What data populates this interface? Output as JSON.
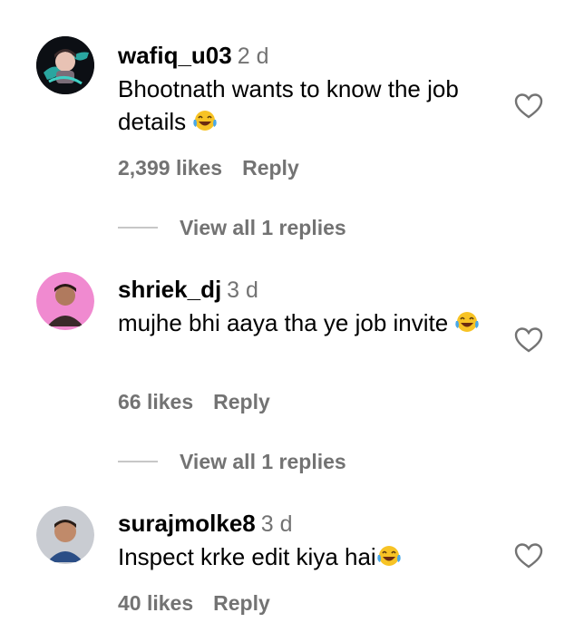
{
  "comments": [
    {
      "username": "wafiq_u03",
      "time": "2 d",
      "text": "Bhootnath wants to know the job details",
      "emoji": "😂",
      "likes": "2,399 likes",
      "reply_label": "Reply",
      "view_replies": "View all 1 replies",
      "avatar_icon": "anime-character-avatar"
    },
    {
      "username": "shriek_dj",
      "time": "3 d",
      "text": "mujhe bhi aaya tha ye job invite",
      "emoji": "😂",
      "likes": "66 likes",
      "reply_label": "Reply",
      "view_replies": "View all 1 replies",
      "avatar_icon": "person-photo-avatar"
    },
    {
      "username": "surajmolke8",
      "time": "3 d",
      "text": "Inspect krke edit kiya hai",
      "emoji": "😂",
      "likes": "40 likes",
      "reply_label": "Reply",
      "avatar_icon": "person-photo-avatar"
    }
  ],
  "icons": {
    "like": "heart-outline-icon",
    "emoji": "tears-of-joy-emoji"
  },
  "colors": {
    "text": "#000000",
    "secondary": "#737373",
    "divider": "#c7c7c7"
  }
}
